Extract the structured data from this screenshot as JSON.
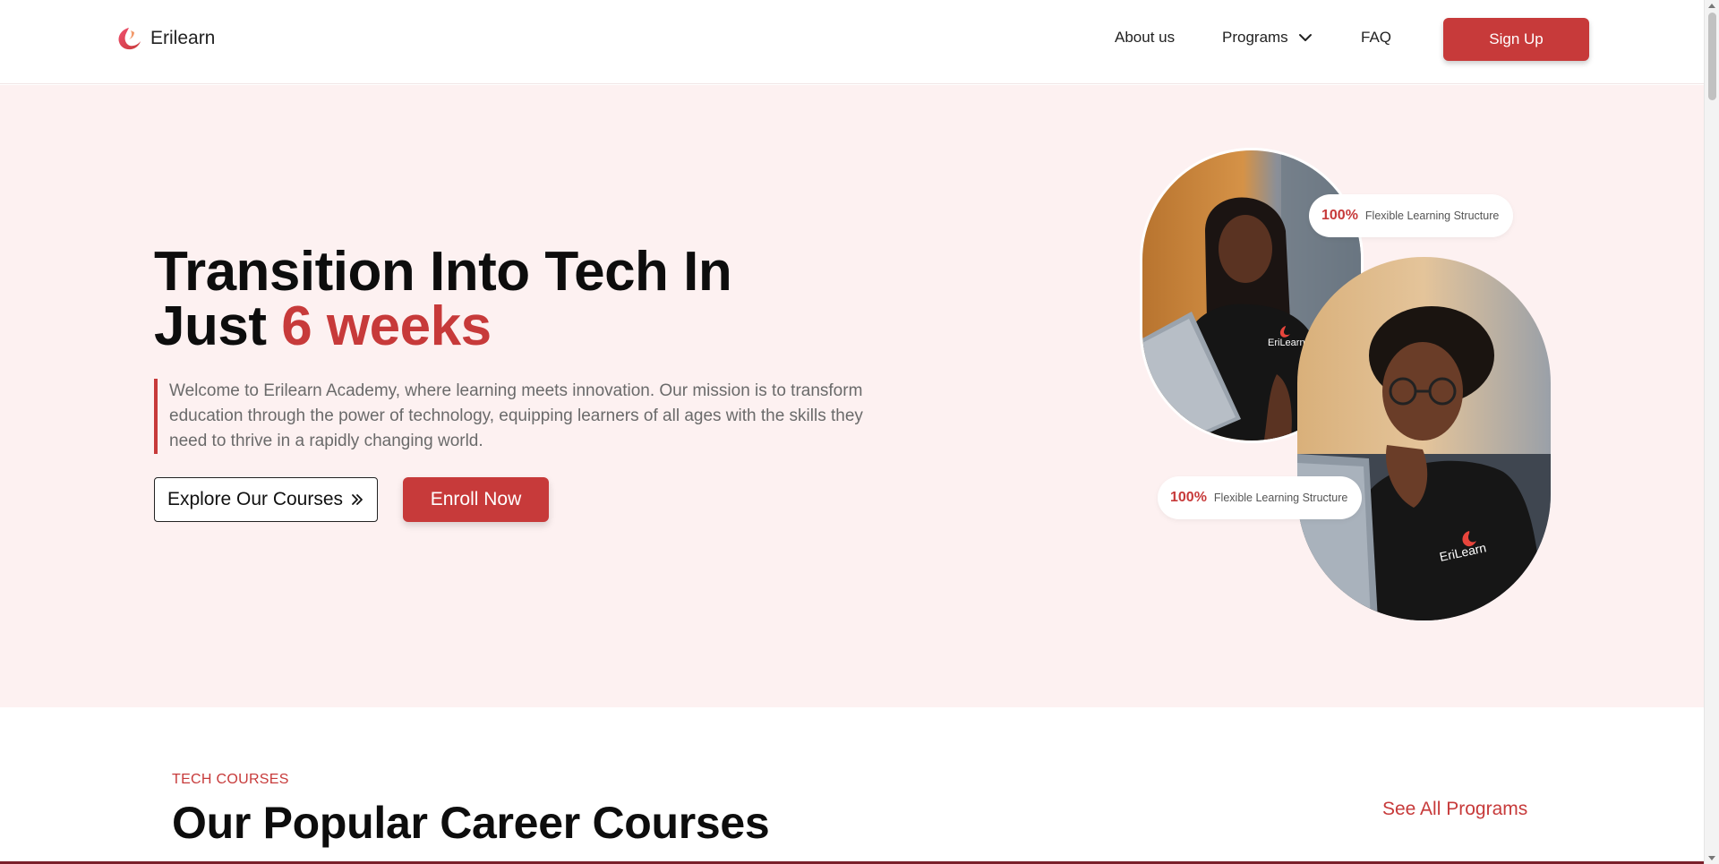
{
  "brand": {
    "name": "Erilearn",
    "color": "#c73a3a"
  },
  "nav": {
    "about": "About us",
    "programs": "Programs",
    "faq": "FAQ",
    "signup": "Sign Up"
  },
  "hero": {
    "title_line1": "Transition Into Tech In",
    "title_line2_prefix": "Just",
    "title_accent": "6 weeks",
    "description": "Welcome to Erilearn Academy, where learning meets innovation. Our mission is to transform education through the power of technology, equipping learners of all ages with the skills they need to thrive in a rapidly changing world.",
    "explore_label": "Explore Our Courses",
    "enroll_label": "Enroll Now",
    "badges": [
      {
        "percent": "100%",
        "label": "Flexible Learning Structure"
      },
      {
        "percent": "100%",
        "label": "Flexible Learning Structure"
      }
    ],
    "photo_shirt_text": "EriLearn"
  },
  "courses": {
    "eyebrow": "TECH COURSES",
    "title": "Our Popular Career Courses",
    "see_all": "See All Programs"
  },
  "icons": {
    "logo": "erilearn-logo-icon",
    "programs_dropdown": "chevron-down-icon",
    "explore_arrows": "double-chevron-right-icon"
  }
}
